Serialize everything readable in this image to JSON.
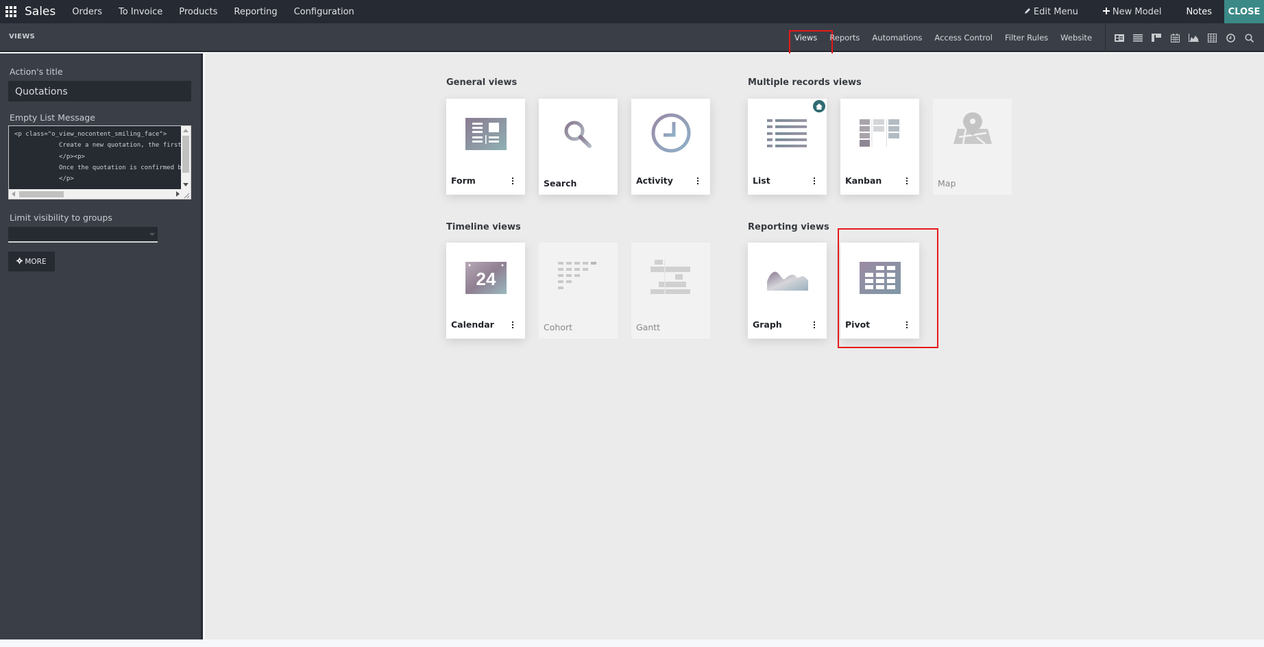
{
  "topbar": {
    "app_icon": "apps-grid-icon",
    "brand": "Sales",
    "menu": [
      "Orders",
      "To Invoice",
      "Products",
      "Reporting",
      "Configuration"
    ],
    "edit_menu": "Edit Menu",
    "new_model": "New Model",
    "notes": "Notes",
    "close": "CLOSE"
  },
  "subbar": {
    "title": "VIEWS",
    "tabs": [
      {
        "label": "Views",
        "active": true
      },
      {
        "label": "Reports"
      },
      {
        "label": "Automations"
      },
      {
        "label": "Access Control"
      },
      {
        "label": "Filter Rules"
      },
      {
        "label": "Website"
      }
    ],
    "view_switcher_icons": [
      "form-view-icon",
      "list-view-icon",
      "kanban-view-icon",
      "calendar-view-icon",
      "graph-view-icon",
      "pivot-view-icon",
      "activity-view-icon",
      "search-view-icon"
    ]
  },
  "sidebar": {
    "action_title_label": "Action's title",
    "action_title_value": "Quotations",
    "empty_list_label": "Empty List Message",
    "empty_list_value": "<p class=\"o_view_nocontent_smiling_face\">\n            Create a new quotation, the first step of a new sale!\n            </p><p>\n            Once the quotation is confirmed by the customer, it becomes a sales order.\n            </p>",
    "groups_label": "Limit visibility to groups",
    "groups_value": "",
    "more_button": "MORE"
  },
  "main": {
    "sections": [
      {
        "title": "General views",
        "cards": [
          {
            "label": "Form",
            "icon": "form-view-icon",
            "enabled": true
          },
          {
            "label": "Search",
            "icon": "search-view-icon",
            "enabled": true
          },
          {
            "label": "Activity",
            "icon": "activity-view-icon",
            "enabled": true
          }
        ]
      },
      {
        "title": "Multiple records views",
        "cards": [
          {
            "label": "List",
            "icon": "list-view-icon",
            "enabled": true,
            "default": true
          },
          {
            "label": "Kanban",
            "icon": "kanban-view-icon",
            "enabled": true
          },
          {
            "label": "Map",
            "icon": "map-view-icon",
            "enabled": false
          }
        ]
      },
      {
        "title": "Timeline views",
        "cards": [
          {
            "label": "Calendar",
            "icon": "calendar-view-icon",
            "enabled": true,
            "icon_text": "24"
          },
          {
            "label": "Cohort",
            "icon": "cohort-view-icon",
            "enabled": false
          },
          {
            "label": "Gantt",
            "icon": "gantt-view-icon",
            "enabled": false
          }
        ]
      },
      {
        "title": "Reporting views",
        "cards": [
          {
            "label": "Graph",
            "icon": "graph-view-icon",
            "enabled": true
          },
          {
            "label": "Pivot",
            "icon": "pivot-view-icon",
            "enabled": true
          }
        ]
      }
    ]
  },
  "colors": {
    "topbar_bg": "#262a32",
    "subbar_bg": "#3a3f47",
    "close_accent": "#3b8a87",
    "highlight_red": "#e81818",
    "main_bg": "#ebebeb"
  }
}
